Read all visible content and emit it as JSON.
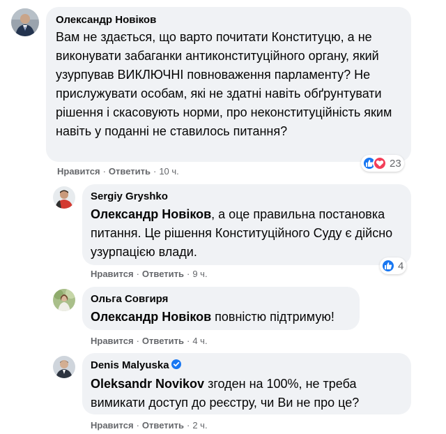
{
  "comments": [
    {
      "author": "Олександр Новіков",
      "mention": "",
      "text": "Вам не здається, що варто почитати Конституцю, а не виконувати забаганки антиконституційного органу, який узурпував ВИКЛЮЧНІ повноваження парламенту? Не прислужувати особам, які не здатні навіть обґрунтувати рішення і скасовують норми, про неконституційність яким навіть у поданні не ставилось питання?",
      "like_label": "Нравится",
      "reply_label": "Ответить",
      "time": "10 ч.",
      "reaction_count": "23",
      "reactions": [
        "like-icon",
        "love-icon"
      ]
    },
    {
      "author": "Sergiy Gryshko",
      "mention": "Олександр Новіков",
      "text": ", а оце правильна постановка питання. Це рішення Конституційного Суду є дійсно узурпацією влади.",
      "like_label": "Нравится",
      "reply_label": "Ответить",
      "time": "9 ч.",
      "reaction_count": "4",
      "reactions": [
        "like-icon"
      ]
    },
    {
      "author": "Ольга Совгиря",
      "mention": "Олександр Новіков",
      "text": " повністю підтримую!",
      "like_label": "Нравится",
      "reply_label": "Ответить",
      "time": "4 ч."
    },
    {
      "author": "Denis Malyuska",
      "verified": true,
      "mention": "Oleksandr Novikov",
      "text": " згоден на 100%, не треба вимикати доступ до реєстру, чи Ви не про це?",
      "like_label": "Нравится",
      "reply_label": "Ответить",
      "time": "2 ч."
    }
  ],
  "colors": {
    "bubble": "#f0f2f5",
    "meta": "#65676b",
    "like": "#1877f2",
    "love": "#f33e58"
  }
}
